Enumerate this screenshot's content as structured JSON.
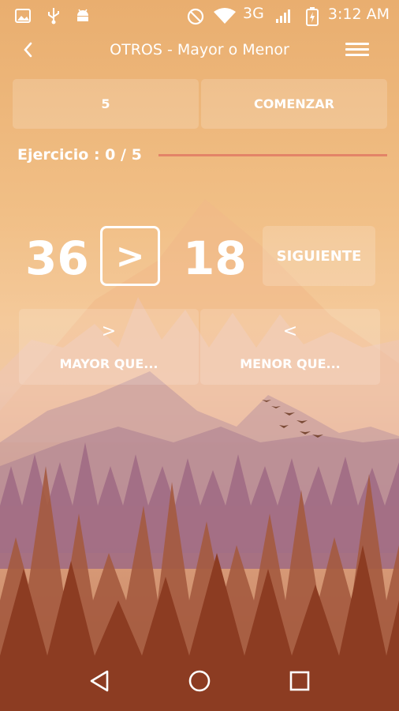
{
  "status_bar": {
    "time": "3:12 AM",
    "network": "3G",
    "left_icons": [
      "image-icon",
      "usb-icon",
      "android-icon"
    ],
    "right_icons": [
      "do-not-disturb-icon",
      "wifi-icon",
      "signal-icon",
      "battery-charging-icon"
    ]
  },
  "app_bar": {
    "title": "OTROS - Mayor o Menor",
    "back_icon": "arrow-back-icon",
    "menu_icon": "hamburger-menu-icon"
  },
  "controls": {
    "count_value": "5",
    "start_label": "COMENZAR"
  },
  "progress": {
    "label": "Ejercicio : 0 / 5",
    "current": 0,
    "total": 5,
    "fraction": 0.0
  },
  "exercise": {
    "left_number": "36",
    "operator": ">",
    "right_number": "18",
    "next_label": "SIGUIENTE"
  },
  "choices": [
    {
      "symbol": ">",
      "label": "MAYOR QUE..."
    },
    {
      "symbol": "<",
      "label": "MENOR QUE..."
    }
  ],
  "colors": {
    "accent": "#e38468",
    "text": "#ffffff"
  },
  "nav_bar": [
    "back-triangle-icon",
    "home-circle-icon",
    "recents-square-icon"
  ]
}
